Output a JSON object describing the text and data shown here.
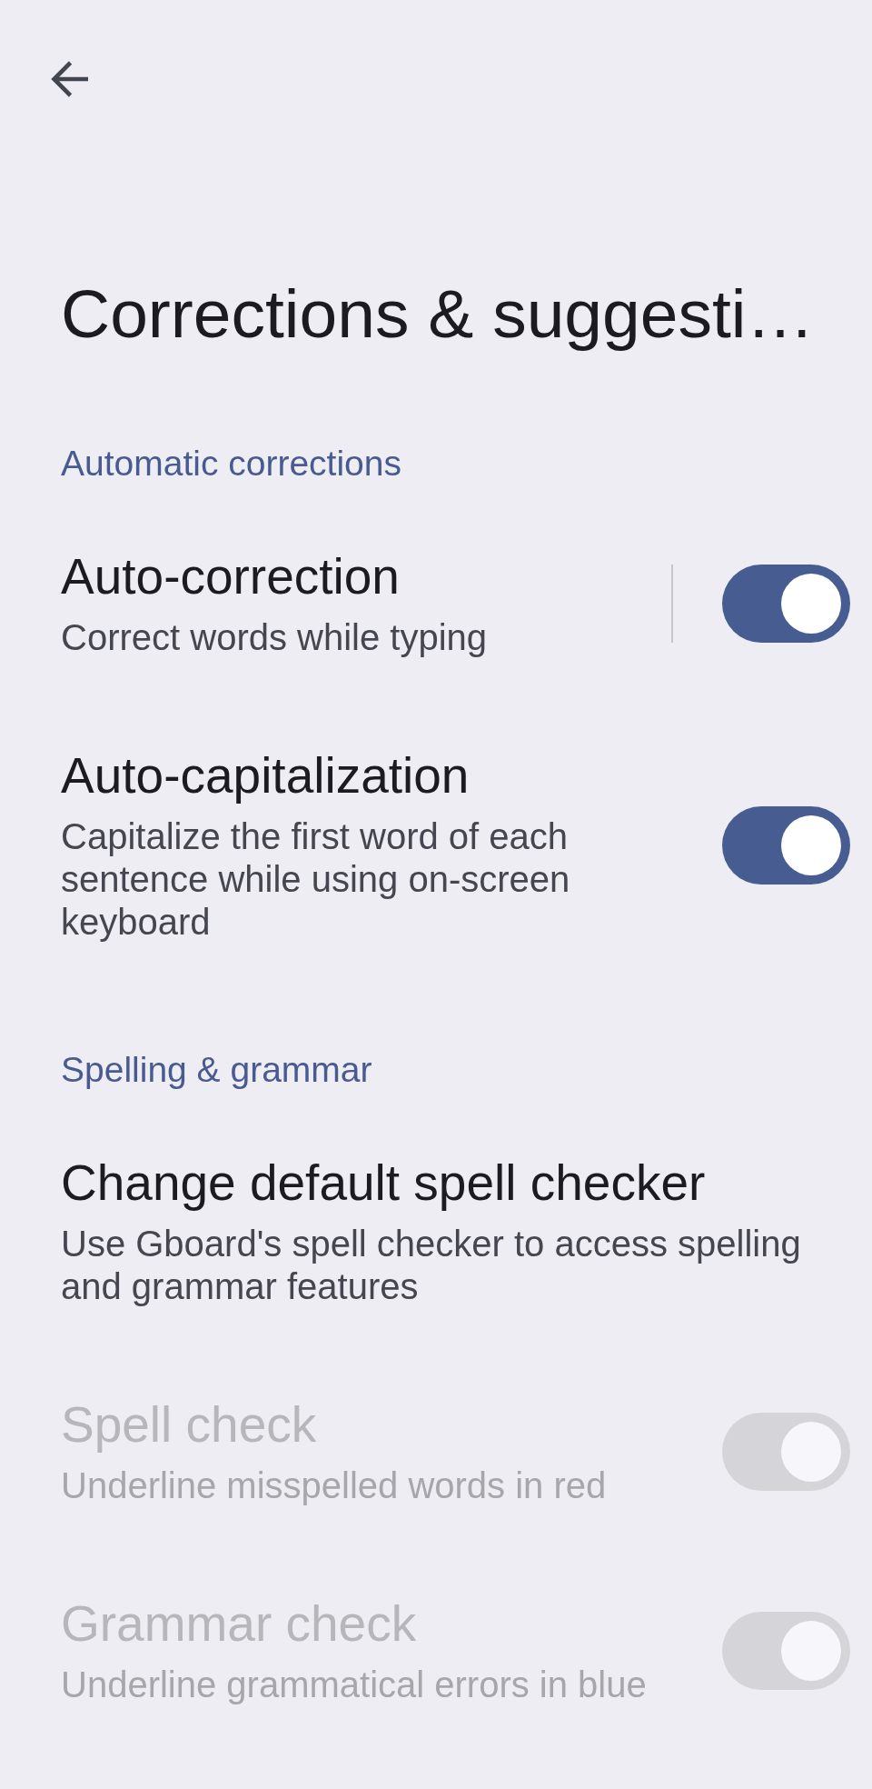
{
  "top_bar": {
    "title": "Corrections & suggesti…"
  },
  "sections": [
    {
      "header": "Automatic corrections",
      "items": [
        {
          "kind": "split_toggle",
          "title": "Auto-correction",
          "description": "Correct words while typing",
          "on": true,
          "disabled": false
        },
        {
          "kind": "toggle",
          "title": "Auto-capitalization",
          "description": "Capitalize the first word of each sentence while using on-screen keyboard",
          "on": true,
          "disabled": false
        }
      ]
    },
    {
      "header": "Spelling & grammar",
      "items": [
        {
          "kind": "link",
          "title": "Change default spell checker",
          "description": "Use Gboard's spell checker to access spelling and grammar features",
          "disabled": false
        },
        {
          "kind": "toggle",
          "title": "Spell check",
          "description": "Underline misspelled words in red",
          "on": true,
          "disabled": true
        },
        {
          "kind": "toggle",
          "title": "Grammar check",
          "description": "Underline grammatical errors in blue",
          "on": true,
          "disabled": true
        }
      ]
    }
  ]
}
